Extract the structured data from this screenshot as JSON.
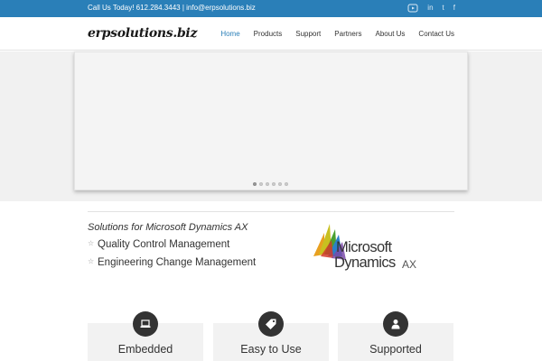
{
  "topbar": {
    "contact": "Call Us Today! 612.284.3443  |  info@erpsolutions.biz",
    "social_icons": [
      "youtube-icon",
      "linkedin-icon",
      "twitter-icon",
      "facebook-icon"
    ],
    "social_glyphs": {
      "linkedin": "in",
      "twitter": "t",
      "facebook": "f"
    }
  },
  "header": {
    "logo": "erpsolutions.biz",
    "nav": [
      {
        "label": "Home",
        "active": true
      },
      {
        "label": "Products"
      },
      {
        "label": "Support"
      },
      {
        "label": "Partners"
      },
      {
        "label": "About Us"
      },
      {
        "label": "Contact Us"
      }
    ]
  },
  "slider": {
    "dots": 6,
    "active_dot": 1
  },
  "solutions": {
    "heading": "Solutions for Microsoft Dynamics AX",
    "items": [
      "Quality Control Management",
      "Engineering Change Management"
    ],
    "bullet_icon": "star-icon"
  },
  "ms_logo": {
    "line1": "Microsoft",
    "line2": "Dynamics",
    "line3": "AX"
  },
  "features": [
    {
      "label": "Embedded",
      "icon": "laptop-icon"
    },
    {
      "label": "Easy to Use",
      "icon": "tag-icon"
    },
    {
      "label": "Supported",
      "icon": "user-icon"
    }
  ],
  "colors": {
    "topbar": "#2a7fb8",
    "nav_active": "#2a7fb8",
    "text": "#333333",
    "feature_bg": "#f2f2f2",
    "feature_circle": "#333333"
  }
}
